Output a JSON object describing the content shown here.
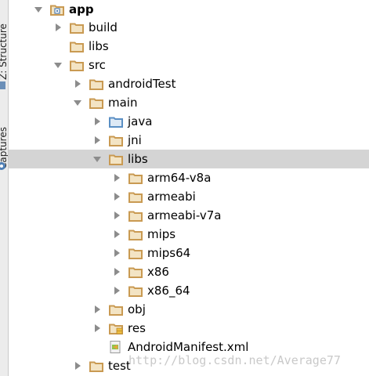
{
  "sidebar": {
    "tabs": [
      {
        "label": "Z: Structure"
      },
      {
        "label": "Captures"
      }
    ]
  },
  "tree": {
    "rows": [
      {
        "label": "app",
        "expanded": true,
        "has_arrow": true,
        "icon": "module-folder-icon",
        "bold": true
      },
      {
        "label": "build",
        "expanded": false,
        "has_arrow": true,
        "icon": "folder-icon"
      },
      {
        "label": "libs",
        "expanded": false,
        "has_arrow": false,
        "icon": "folder-icon"
      },
      {
        "label": "src",
        "expanded": true,
        "has_arrow": true,
        "icon": "folder-icon"
      },
      {
        "label": "androidTest",
        "expanded": false,
        "has_arrow": true,
        "icon": "folder-icon"
      },
      {
        "label": "main",
        "expanded": true,
        "has_arrow": true,
        "icon": "folder-icon"
      },
      {
        "label": "java",
        "expanded": false,
        "has_arrow": true,
        "icon": "source-folder-icon"
      },
      {
        "label": "jni",
        "expanded": false,
        "has_arrow": true,
        "icon": "folder-icon"
      },
      {
        "label": "libs",
        "expanded": true,
        "has_arrow": true,
        "icon": "folder-icon",
        "selected": true
      },
      {
        "label": "arm64-v8a",
        "expanded": false,
        "has_arrow": true,
        "icon": "folder-icon"
      },
      {
        "label": "armeabi",
        "expanded": false,
        "has_arrow": true,
        "icon": "folder-icon"
      },
      {
        "label": "armeabi-v7a",
        "expanded": false,
        "has_arrow": true,
        "icon": "folder-icon"
      },
      {
        "label": "mips",
        "expanded": false,
        "has_arrow": true,
        "icon": "folder-icon"
      },
      {
        "label": "mips64",
        "expanded": false,
        "has_arrow": true,
        "icon": "folder-icon"
      },
      {
        "label": "x86",
        "expanded": false,
        "has_arrow": true,
        "icon": "folder-icon"
      },
      {
        "label": "x86_64",
        "expanded": false,
        "has_arrow": true,
        "icon": "folder-icon"
      },
      {
        "label": "obj",
        "expanded": false,
        "has_arrow": true,
        "icon": "folder-icon"
      },
      {
        "label": "res",
        "expanded": false,
        "has_arrow": true,
        "icon": "resource-folder-icon"
      },
      {
        "label": "AndroidManifest.xml",
        "expanded": false,
        "has_arrow": false,
        "icon": "manifest-file-icon"
      },
      {
        "label": "test",
        "expanded": false,
        "has_arrow": true,
        "icon": "folder-icon"
      }
    ]
  },
  "watermark": {
    "text": "http://blog.csdn.net/Average77"
  },
  "colors": {
    "folder": "#c99a52",
    "folder_fill": "#f3e4c4",
    "source_folder": "#5a8fc4",
    "selection": "#d4d4d4",
    "arrow": "#8c8c8c"
  }
}
